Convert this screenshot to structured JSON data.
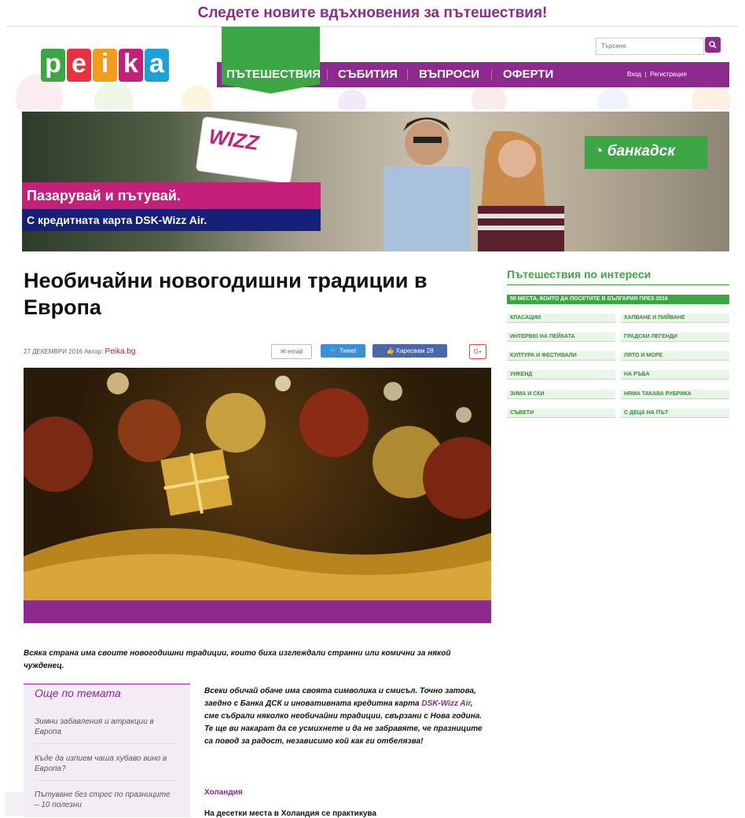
{
  "promo_banner": "Следете новите вдъхновения за пътешествия!",
  "search": {
    "placeholder": "Търсене"
  },
  "nav": {
    "items": [
      "ПЪТЕШЕСТВИЯ",
      "СЪБИТИЯ",
      "ВЪПРОСИ",
      "ОФЕРТИ"
    ],
    "login": "Вход",
    "register": "Регистрация"
  },
  "hero_ad": {
    "headline": "Пазарувай и пътувай.",
    "subline": "С кредитната карта DSK-Wizz Air.",
    "card_logo": "WIZZ",
    "bank": "банкадск"
  },
  "article": {
    "title": "Необичайни новогодишни традиции в Европа",
    "date_prefix": "27 ДЕКЕМВРИ 2016 Автор:",
    "author": "Peika.bg",
    "share": {
      "email": "email",
      "tweet": "Tweet",
      "like": "Харесвам 28",
      "gplus": "G+"
    },
    "lead": "Всяка страна има своите новогодишни традиции, които биха изглеждали странни или комични за някой чужденец.",
    "body_p1_a": "Всеки обичай обаче има своята символика и смисъл. Точно затова, заедно с Банка ДСК и иновативната кредитна карта ",
    "body_link": "DSK-Wizz Air",
    "body_p1_b": ", сме събрали няколко необичайни традиции, свързани с Нова година. Те ще ви накарат да се усмихнете и да не забравяте, че празниците са повод за радост, независимо кой как ги отбелязва!",
    "subheading": "Холандия",
    "body_p2": "На десетки места в Холандия се практикува"
  },
  "related": {
    "title": "Още по темата",
    "items": [
      "Зимни забавления и атракции в Европа",
      "Къде да изпием чаша хубаво вино в Европа?",
      "Пътуване без стрес по празниците – 10 полезни"
    ]
  },
  "sidebar": {
    "title": "Пътешествия по интереси",
    "featured": "50 МЕСТА, КОИТО ДА ПОСЕТИТЕ В БЪЛГАРИЯ ПРЕЗ 2016",
    "tags": [
      "КЛАСАЦИИ",
      "ХАПВАНЕ И ПИЙВАНЕ",
      "ИНТЕРВЮ НА ПЕЙКАТА",
      "ГРАДСКИ ЛЕГЕНДИ",
      "КУЛТУРА И ФЕСТИВАЛИ",
      "ЛЯТО И МОРЕ",
      "УИКЕНД",
      "НА РЪБА",
      "ЗИМА И СКИ",
      "НЯМА ТАКАВА РУБРИКА",
      "СЪВЕТИ",
      "С ДЕЦА НА ПЪТ"
    ]
  },
  "colors": {
    "brand_purple": "#8e2a8e",
    "brand_green": "#3da644",
    "ad_pink": "#c52079",
    "ad_blue": "#16207a"
  }
}
